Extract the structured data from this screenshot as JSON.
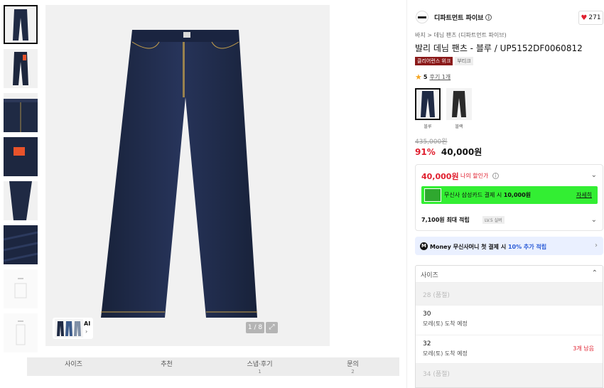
{
  "gallery": {
    "thumbnails": [
      {
        "kind": "jeans-front",
        "active": true
      },
      {
        "kind": "jeans-back-tag",
        "active": false
      },
      {
        "kind": "jeans-waist-detail",
        "active": false
      },
      {
        "kind": "jeans-back-pocket-tag",
        "active": false
      },
      {
        "kind": "jeans-leg-detail",
        "active": false
      },
      {
        "kind": "denim-texture",
        "active": false
      },
      {
        "kind": "size-chart",
        "active": false
      },
      {
        "kind": "size-chart-2",
        "active": false
      }
    ],
    "ai_label": "AI",
    "pager": "1 / 8"
  },
  "tabs": [
    {
      "label": "사이즈",
      "count": ""
    },
    {
      "label": "추천",
      "count": ""
    },
    {
      "label": "스냅·후기",
      "count": "1"
    },
    {
      "label": "문의",
      "count": "2"
    }
  ],
  "product": {
    "brand": "디파트먼트 파이브",
    "likes": "271",
    "breadcrumb": "바지 > 데님 팬츠 (디파트먼트 파이브)",
    "title": "발리 데님 팬츠 - 블루 / UP5152DF0060812",
    "badge_clearance": "클리어런스 위크",
    "badge_boutique": "부티크",
    "rating": "5",
    "review_link": "후기 1개",
    "colors": [
      {
        "label": "블루",
        "selected": true,
        "shade": "#1f2a44"
      },
      {
        "label": "블랙",
        "selected": false,
        "shade": "#2a2a2a"
      }
    ],
    "original_price": "435,000원",
    "discount": "91%",
    "price": "40,000원"
  },
  "benefit": {
    "my_price": "40,000원",
    "my_price_label": "나의 할인가",
    "card_text_prefix": "무신사 삼성카드 결제 시 ",
    "card_text_amount": "10,000원",
    "card_link": "자세히",
    "points": "7,100원 최대 적립",
    "level": "LV.5 실버"
  },
  "money": {
    "text_prefix": "Money 무신사머니 첫 결제 시 ",
    "text_pct": "10% 추가 적립"
  },
  "size": {
    "header": "사이즈",
    "options": [
      {
        "num": "28 (품절)",
        "eta": "",
        "left": "",
        "sold": true
      },
      {
        "num": "30",
        "eta": "모레(토) 도착 예정",
        "left": "",
        "sold": false
      },
      {
        "num": "32",
        "eta": "모레(토) 도착 예정",
        "left": "3개 남음",
        "sold": false
      },
      {
        "num": "34 (품절)",
        "eta": "",
        "left": "",
        "sold": true
      }
    ]
  },
  "colors": {
    "sale_red": "#e0202f",
    "card_green": "#33ee33",
    "denim": "#1f2a44",
    "money_bg": "#eaf0ff"
  }
}
